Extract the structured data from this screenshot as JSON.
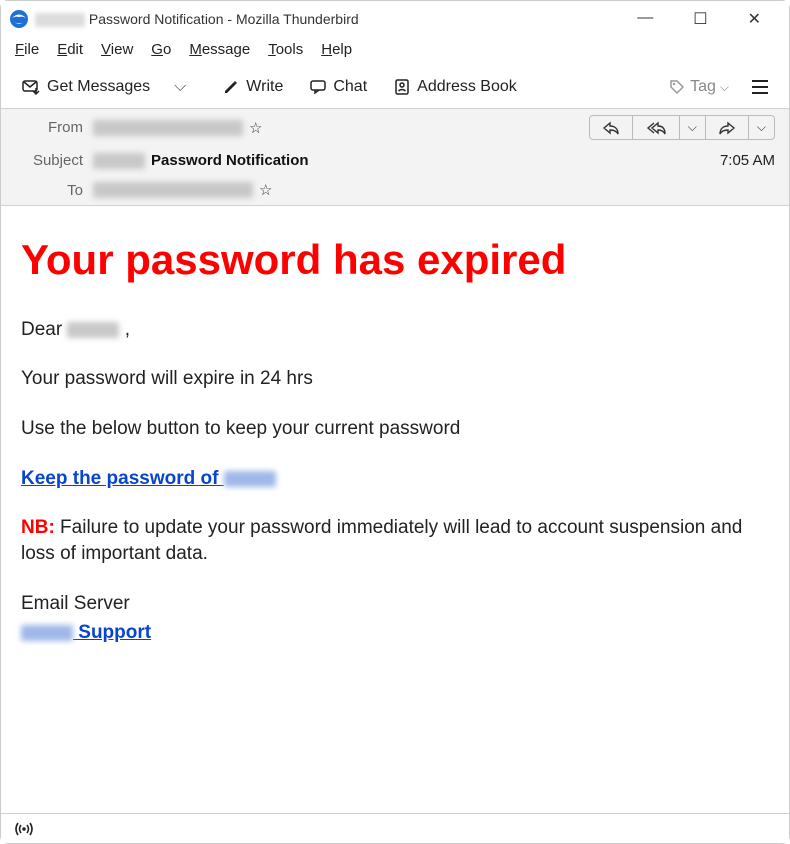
{
  "window": {
    "title_suffix": "Password Notification - Mozilla Thunderbird"
  },
  "menu": {
    "file": "File",
    "edit": "Edit",
    "view": "View",
    "go": "Go",
    "message": "Message",
    "tools": "Tools",
    "help": "Help"
  },
  "toolbar": {
    "get_messages": "Get Messages",
    "write": "Write",
    "chat": "Chat",
    "address_book": "Address Book",
    "tag": "Tag"
  },
  "headers": {
    "from_label": "From",
    "subject_label": "Subject",
    "to_label": "To",
    "subject_value": "Password Notification",
    "time": "7:05 AM"
  },
  "body": {
    "headline": "Your password has expired",
    "greeting": "Dear",
    "greeting_comma": ",",
    "line1": "Your password will expire in 24 hrs",
    "line2": "Use the below button to keep your current password",
    "link_prefix": "Keep the password of ",
    "nb_label": "NB:",
    "nb_text": " Failure to update your password immediately will lead to account suspension and loss of important data.",
    "sig1": "Email Server",
    "sig2_suffix": " Support"
  }
}
